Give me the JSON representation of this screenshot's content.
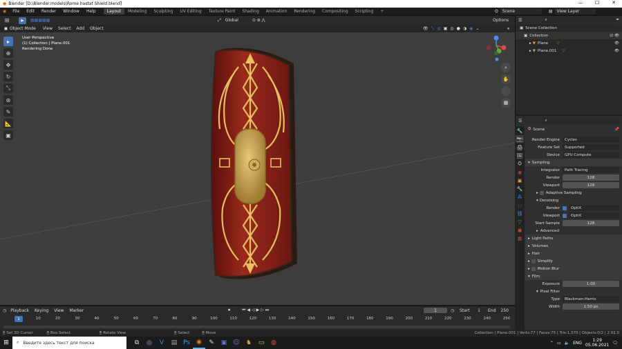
{
  "titlebar": {
    "title": "Blender [D:\\Blender.models\\Rome hastat Shield.blend]"
  },
  "menu": [
    "File",
    "Edit",
    "Render",
    "Window",
    "Help"
  ],
  "workspaces": [
    "Layout",
    "Modeling",
    "Sculpting",
    "UV Editing",
    "Texture Paint",
    "Shading",
    "Animation",
    "Rendering",
    "Compositing",
    "Scripting"
  ],
  "active_workspace": "Layout",
  "scene": "Scene",
  "view_layer": "View Layer",
  "viewport": {
    "orientation": "Global",
    "options": "Options",
    "mode": "Object Mode",
    "menus": [
      "View",
      "Select",
      "Add",
      "Object"
    ],
    "overlay_lines": [
      "User Perspective",
      "(1) Collection | Plane.001",
      "Rendering Done"
    ]
  },
  "outliner": {
    "root": "Scene Collection",
    "collection": "Collection",
    "items": [
      "Plane",
      "Plane.001"
    ]
  },
  "properties": {
    "scene_label": "Scene",
    "render_engine_label": "Render Engine",
    "render_engine": "Cycles",
    "feature_set_label": "Feature Set",
    "feature_set": "Supported",
    "device_label": "Device",
    "device": "GPU Compute",
    "sampling": "Sampling",
    "integrator_label": "Integrator",
    "integrator": "Path Tracing",
    "render_label": "Render",
    "render_samples": "128",
    "viewport_label": "Viewport",
    "viewport_samples": "128",
    "adaptive_sampling": "Adaptive Sampling",
    "denoising": "Denoising",
    "denoise_render_label": "Render",
    "denoise_render": "OptiX",
    "denoise_viewport_label": "Viewport",
    "denoise_viewport": "OptiX",
    "start_sample_label": "Start Sample",
    "start_sample": "128",
    "advanced": "Advanced",
    "light_paths": "Light Paths",
    "volumes": "Volumes",
    "hair": "Hair",
    "simplify": "Simplify",
    "motion_blur": "Motion Blur",
    "film": "Film",
    "exposure_label": "Exposure",
    "exposure": "1.00",
    "pixel_filter": "Pixel Filter",
    "type_label": "Type",
    "type": "Blackman-Harris",
    "width_label": "Width",
    "width": "1.50 px"
  },
  "timeline": {
    "menus": [
      "Playback",
      "Keying",
      "View",
      "Marker"
    ],
    "current_frame": "1",
    "start_label": "Start",
    "start": "1",
    "end_label": "End",
    "end": "250",
    "ticks": [
      "0",
      "10",
      "20",
      "30",
      "40",
      "50",
      "60",
      "70",
      "80",
      "90",
      "100",
      "110",
      "120",
      "130",
      "140",
      "150",
      "160",
      "170",
      "180",
      "190",
      "200",
      "210",
      "220",
      "230",
      "240",
      "250"
    ]
  },
  "status": {
    "set_cursor": "Set 3D Cursor",
    "box_select": "Box Select",
    "rotate_view": "Rotate View",
    "select": "Select",
    "move": "Move",
    "stats": "Collection | Plane.001 | Verts:77 | Faces:75 | Tris:1,370 | Objects:0/2 | 2.92.0"
  },
  "taskbar": {
    "search_placeholder": "Введите здесь текст для поиска",
    "lang": "ENG",
    "time": "1:29",
    "date": "05.06.2021"
  }
}
